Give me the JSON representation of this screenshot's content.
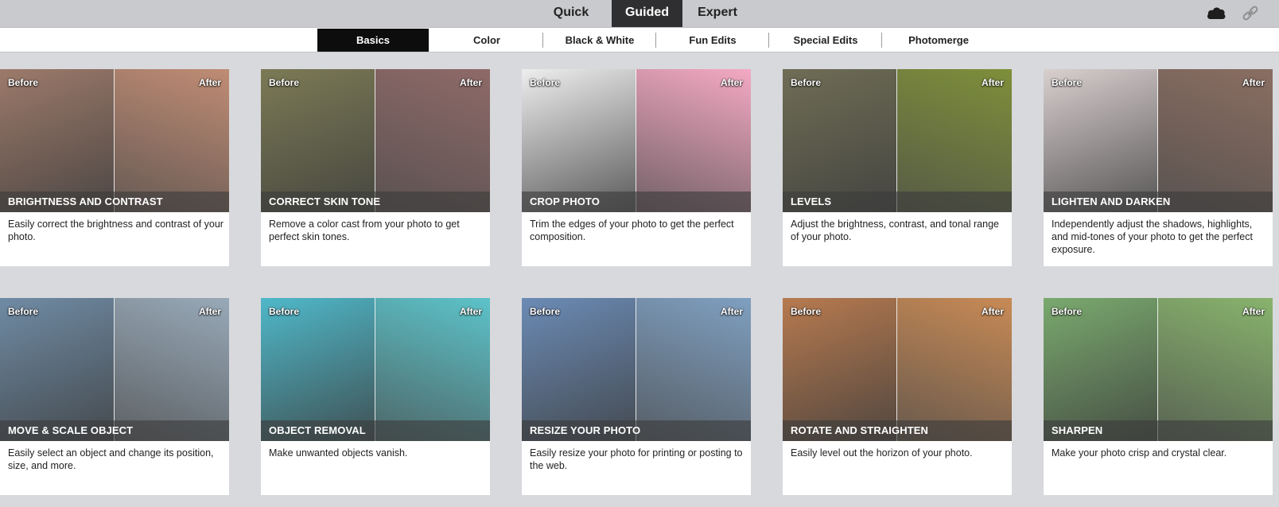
{
  "modes": [
    {
      "label": "Quick",
      "active": false
    },
    {
      "label": "Guided",
      "active": true
    },
    {
      "label": "Expert",
      "active": false
    }
  ],
  "icons": {
    "cloud": "cloud-icon",
    "link": "link-icon"
  },
  "categories": [
    {
      "label": "Basics",
      "active": true
    },
    {
      "label": "Color",
      "active": false
    },
    {
      "label": "Black & White",
      "active": false
    },
    {
      "label": "Fun Edits",
      "active": false
    },
    {
      "label": "Special Edits",
      "active": false
    },
    {
      "label": "Photomerge",
      "active": false
    }
  ],
  "labels": {
    "before": "Before",
    "after": "After"
  },
  "cards": [
    {
      "title": "BRIGHTNESS AND CONTRAST",
      "desc": "Easily correct the brightness and contrast of your photo.",
      "before_color": "#9c7a6a",
      "after_color": "#c08c74"
    },
    {
      "title": "CORRECT SKIN TONE",
      "desc": "Remove a color cast from your photo to get perfect skin tones.",
      "before_color": "#7b7a55",
      "after_color": "#8e6a68"
    },
    {
      "title": "CROP PHOTO",
      "desc": "Trim the edges of your photo to get the perfect composition.",
      "before_color": "#eeeeee",
      "after_color": "#f4a9c3"
    },
    {
      "title": "LEVELS",
      "desc": "Adjust the brightness, contrast, and tonal range of your photo.",
      "before_color": "#6f6d55",
      "after_color": "#7e8f3a"
    },
    {
      "title": "LIGHTEN AND DARKEN",
      "desc": "Independently adjust the shadows, highlights, and mid-tones of your photo to get the perfect exposure.",
      "before_color": "#d9cfcf",
      "after_color": "#8a6e62"
    },
    {
      "title": "MOVE & SCALE OBJECT",
      "desc": "Easily select an object and change its position, size, and more.",
      "before_color": "#6f8ba4",
      "after_color": "#98a9b8"
    },
    {
      "title": "OBJECT REMOVAL",
      "desc": "Make unwanted objects vanish.",
      "before_color": "#4fb8c9",
      "after_color": "#5cc3c9"
    },
    {
      "title": "RESIZE YOUR PHOTO",
      "desc": "Easily resize your photo for printing or posting to the web.",
      "before_color": "#6b8bb5",
      "after_color": "#7f9fc0"
    },
    {
      "title": "ROTATE AND STRAIGHTEN",
      "desc": "Easily level out the horizon of your photo.",
      "before_color": "#b77a4f",
      "after_color": "#c88a55"
    },
    {
      "title": "SHARPEN",
      "desc": "Make your photo crisp and crystal clear.",
      "before_color": "#7aa96e",
      "after_color": "#88b36d"
    }
  ]
}
